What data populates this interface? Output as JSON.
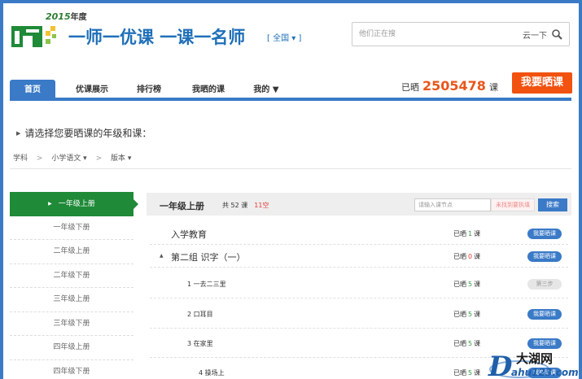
{
  "header": {
    "logo_year": "2015",
    "logo_year_suffix": "年度",
    "slogan": "一师一优课 一课一名师",
    "region": "[ 全国 ▾ ]",
    "search_placeholder": "他们正在搜",
    "search_button": "云一下"
  },
  "nav": {
    "tabs": [
      "首页",
      "优课展示",
      "排行榜",
      "我晒的课",
      "我的 ▼"
    ],
    "active_index": 0,
    "shown_prefix": "已晒",
    "shown_number": "2505478",
    "shown_suffix": "课",
    "show_button": "我要晒课"
  },
  "prompt": "请选择您要晒课的年级和课：",
  "breadcrumb": [
    "学科",
    ">",
    "小学语文 ▾",
    ">",
    "版本 ▾"
  ],
  "sidebar": {
    "items": [
      "一年级上册",
      "一年级下册",
      "二年级上册",
      "二年级下册",
      "三年级上册",
      "三年级下册",
      "四年级上册",
      "四年级下册"
    ],
    "active_index": 0
  },
  "main": {
    "title": "一年级上册",
    "count_text": "共 52 课",
    "empty_text": "11空",
    "node_placeholder": "请输入课节点",
    "notfound_button": "未找到要执填",
    "search_button": "搜索",
    "rows": [
      {
        "label": "入学教育",
        "level": 0,
        "stat_prefix": "已晒",
        "stat_num": "1",
        "stat_suffix": "课",
        "num_color": "green",
        "button": "我要晒课",
        "button_style": "blue"
      },
      {
        "label": "第二组 识字（一）",
        "level": 0,
        "stat_prefix": "已晒",
        "stat_num": "0",
        "stat_suffix": "课",
        "num_color": "red",
        "button": "我要晒课",
        "button_style": "blue"
      },
      {
        "label": "1 一去二三里",
        "level": 1,
        "stat_prefix": "已晒",
        "stat_num": "5",
        "stat_suffix": "课",
        "num_color": "green",
        "button": "第三步",
        "button_style": "grey"
      },
      {
        "label": "2 口耳目",
        "level": 1,
        "stat_prefix": "已晒",
        "stat_num": "5",
        "stat_suffix": "课",
        "num_color": "green",
        "button": "我要晒课",
        "button_style": "blue"
      },
      {
        "label": "3 在家里",
        "level": 1,
        "stat_prefix": "已晒",
        "stat_num": "5",
        "stat_suffix": "课",
        "num_color": "green",
        "button": "我要晒课",
        "button_style": "blue"
      },
      {
        "label": "4 操场上",
        "level": 1,
        "stat_prefix": "已晒",
        "stat_num": "5",
        "stat_suffix": "课",
        "num_color": "green",
        "button": "我要晒课",
        "button_style": "blue"
      }
    ]
  },
  "watermark": {
    "big": "大湖网",
    "letter": "D",
    "small": "ahu123.com"
  },
  "colors": {
    "primary": "#3a7ac7",
    "accent_orange": "#f2520f",
    "sidebar_active": "#1f8a38"
  }
}
